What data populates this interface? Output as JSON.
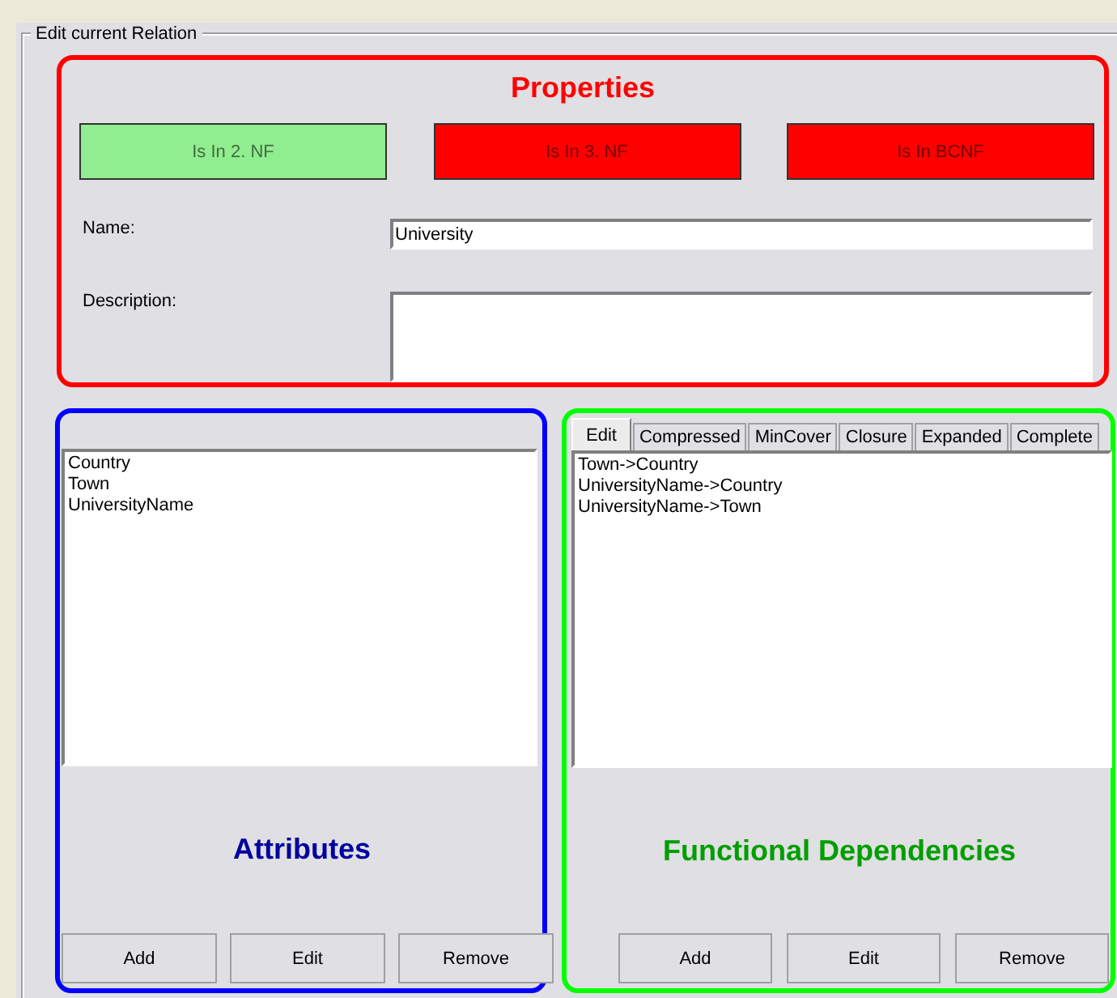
{
  "group_title": "Edit current Relation",
  "properties": {
    "label": "Properties",
    "color": "#ff0000",
    "badges": [
      {
        "text": "Is In 2. NF",
        "color": "#90ee90"
      },
      {
        "text": "Is In 3. NF",
        "color": "#ff0000"
      },
      {
        "text": "Is In BCNF",
        "color": "#ff0000"
      }
    ],
    "name_label": "Name:",
    "name_value": "University",
    "description_label": "Description:"
  },
  "attributes": {
    "label": "Attributes",
    "color": "#0000ff",
    "items": [
      "Country",
      "Town",
      "UniversityName"
    ],
    "buttons": [
      "Add",
      "Edit",
      "Remove"
    ]
  },
  "dependencies": {
    "label": "Functional Dependencies",
    "color": "#00ff00",
    "tabs": [
      {
        "label": "Edit",
        "selected": true
      },
      {
        "label": "Compressed",
        "selected": false
      },
      {
        "label": "MinCover",
        "selected": false
      },
      {
        "label": "Closure",
        "selected": false
      },
      {
        "label": "Expanded",
        "selected": false
      },
      {
        "label": "Complete",
        "selected": false
      }
    ],
    "items": [
      "Town->Country",
      "UniversityName->Country",
      "UniversityName->Town"
    ],
    "buttons": [
      "Add",
      "Edit",
      "Remove"
    ]
  }
}
